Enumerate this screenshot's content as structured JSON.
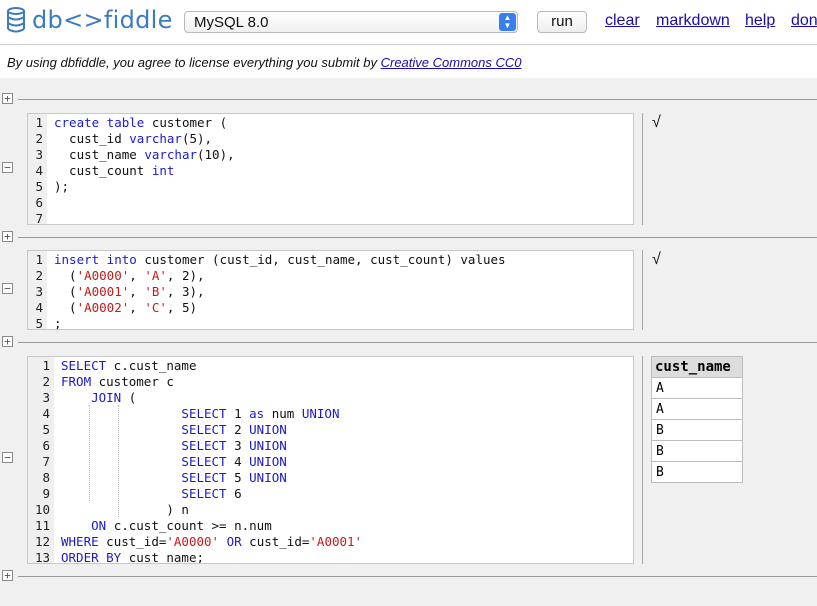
{
  "header": {
    "logo_text": "db<>fiddle",
    "db_select": "MySQL 8.0",
    "run_label": "run",
    "nav": [
      "clear",
      "markdown",
      "help",
      "don"
    ]
  },
  "license": {
    "text": "By using dbfiddle, you agree to license everything you submit by ",
    "link": "Creative Commons CC0"
  },
  "batches": [
    {
      "line_numbers": [
        "1",
        "2",
        "3",
        "4",
        "5",
        "6",
        "7"
      ],
      "result_mark": "√"
    },
    {
      "line_numbers": [
        "1",
        "2",
        "3",
        "4",
        "5"
      ],
      "result_mark": "√"
    },
    {
      "line_numbers": [
        "1",
        "2",
        "3",
        "4",
        "5",
        "6",
        "7",
        "8",
        "9",
        "10",
        "11",
        "12",
        "13"
      ],
      "result": {
        "columns": [
          "cust_name"
        ],
        "rows": [
          "A",
          "A",
          "B",
          "B",
          "B"
        ]
      }
    }
  ],
  "code": {
    "b1": [
      "create table customer (",
      "  cust_id varchar(5),",
      "  cust_name varchar(10),",
      "  cust_count int",
      ");"
    ],
    "b2": [
      "insert into customer (cust_id, cust_name, cust_count) values",
      "  ('A0000', 'A', 2),",
      "  ('A0001', 'B', 3),",
      "  ('A0002', 'C', 5)",
      ";"
    ],
    "b3": [
      "SELECT c.cust_name",
      "FROM customer c",
      "    JOIN (",
      "                SELECT 1 as num UNION",
      "                SELECT 2 UNION",
      "                SELECT 3 UNION",
      "                SELECT 4 UNION",
      "                SELECT 5 UNION",
      "                SELECT 6",
      "              ) n",
      "    ON c.cust_count >= n.num",
      "WHERE cust_id='A0000' OR cust_id='A0001'",
      "ORDER BY cust_name;"
    ]
  },
  "icons": {
    "logo": "database-icon",
    "expand": "plus-box-icon",
    "collapse": "minus-box-icon",
    "dropdown": "chevron-updown-icon"
  },
  "colors": {
    "link": "#1a0dab",
    "keyword": "#1a1acf",
    "string": "#c41a16",
    "logo": "#3d7bc1"
  }
}
